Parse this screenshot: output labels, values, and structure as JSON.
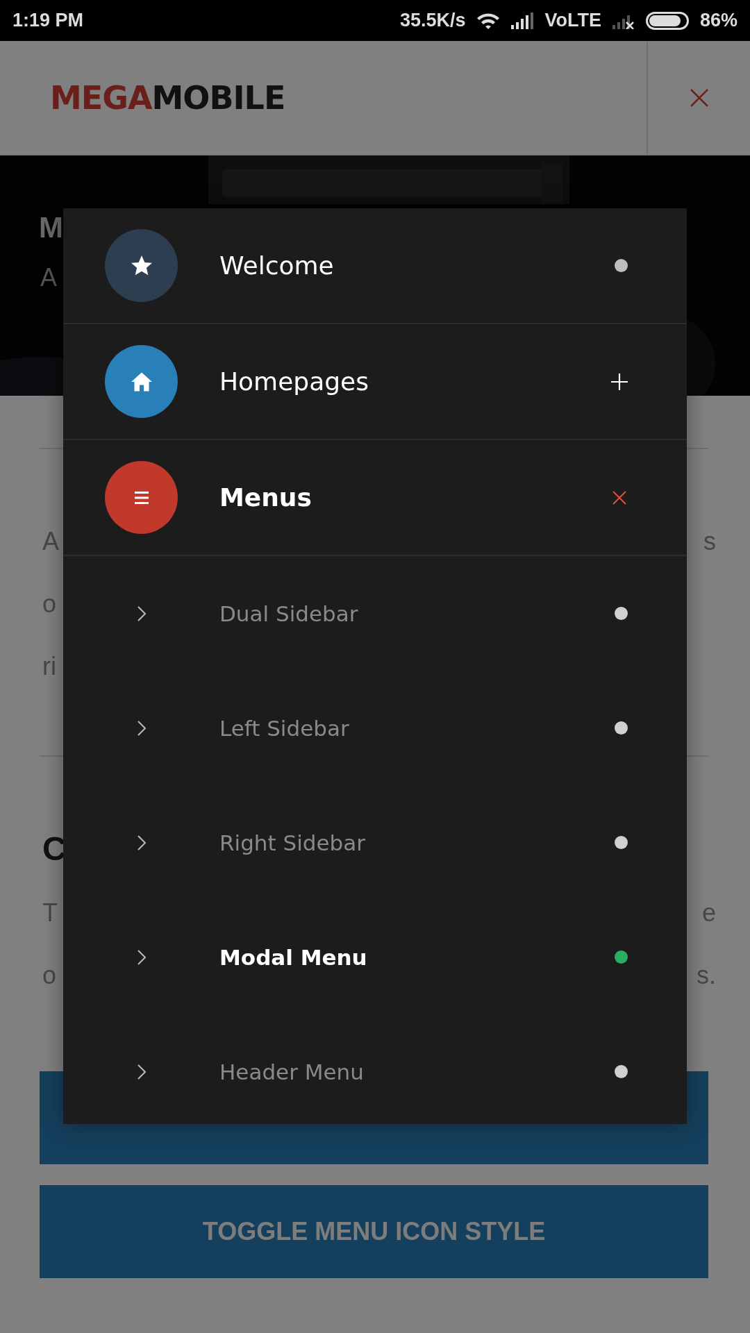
{
  "status_bar": {
    "time": "1:19 PM",
    "network_speed": "35.5K/s",
    "network_type": "VoLTE",
    "battery": "86%"
  },
  "header": {
    "logo_accent": "MEGA",
    "logo_rest": "MOBILE"
  },
  "hero": {
    "title": "M",
    "subtitle": "A"
  },
  "section_1": {
    "lines": [
      {
        "left": "A",
        "right": "s"
      },
      {
        "left": "o"
      },
      {
        "left": "ri"
      }
    ]
  },
  "section_2": {
    "title": "C",
    "lines": [
      {
        "left": "T",
        "right": "e"
      },
      {
        "left": "o",
        "right": "s."
      }
    ]
  },
  "buttons": [
    {
      "label": "TOGGLE MENU ICON STYLE"
    }
  ],
  "menu": [
    {
      "label": "Welcome",
      "color": "#2d3e50",
      "kind": "link",
      "expanded": false
    },
    {
      "label": "Homepages",
      "color": "#2980b9",
      "kind": "group",
      "expanded": false
    },
    {
      "label": "Menus",
      "color": "#c0392b",
      "kind": "group",
      "expanded": true,
      "children": [
        {
          "label": "Dual Sidebar",
          "selected": false
        },
        {
          "label": "Left Sidebar",
          "selected": false
        },
        {
          "label": "Right Sidebar",
          "selected": false
        },
        {
          "label": "Modal Menu",
          "selected": true
        },
        {
          "label": "Header Menu",
          "selected": false
        }
      ]
    }
  ]
}
